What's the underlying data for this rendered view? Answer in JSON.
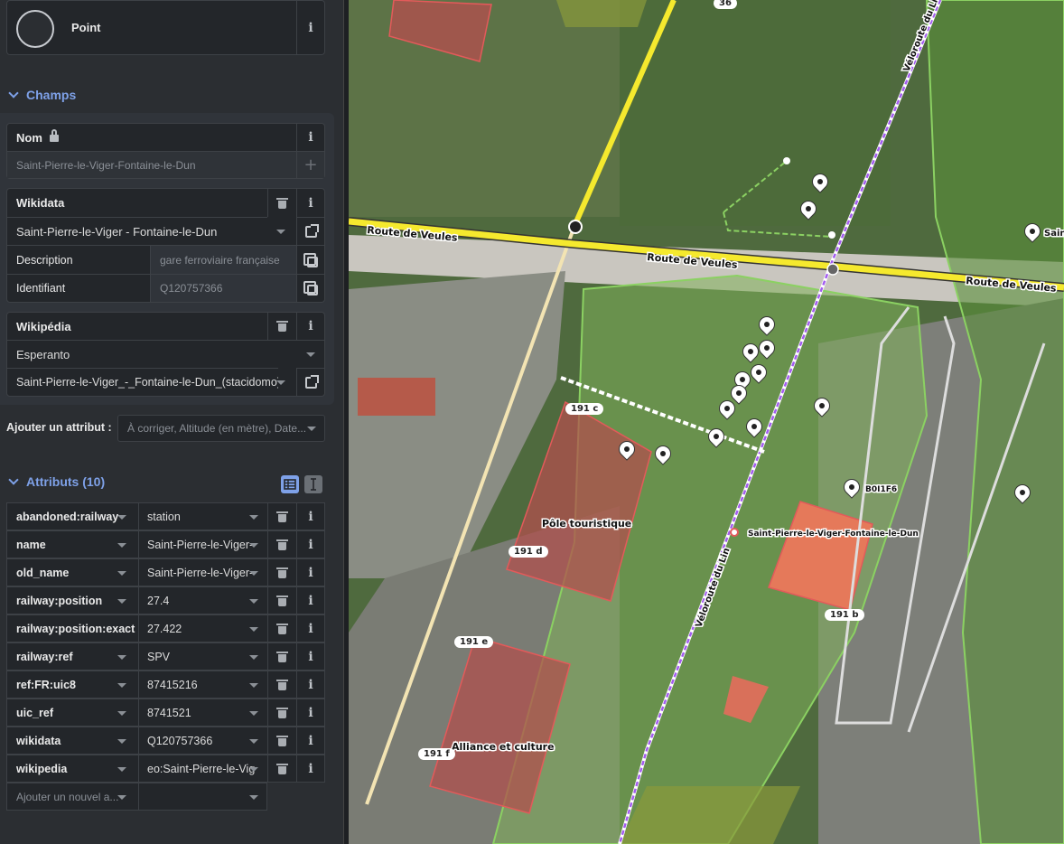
{
  "preset": {
    "name": "Point",
    "icon": "circle-icon"
  },
  "fields_section": {
    "title": "Champs"
  },
  "name_field": {
    "label": "Nom",
    "placeholder": "Saint-Pierre-le-Viger-Fontaine-le-Dun"
  },
  "wikidata_field": {
    "label": "Wikidata",
    "value": "Saint-Pierre-le-Viger - Fontaine-le-Dun",
    "description_label": "Description",
    "description_value": "gare ferroviaire française",
    "id_label": "Identifiant",
    "id_value": "Q120757366"
  },
  "wikipedia_field": {
    "label": "Wikipédia",
    "language": "Esperanto",
    "title": "Saint-Pierre-le-Viger_-_Fontaine-le-Dun_(stacidomo)"
  },
  "add_field": {
    "label": "Ajouter un attribut :",
    "placeholder": "À corriger, Altitude (en mètre), Date..."
  },
  "attributes_section": {
    "title": "Attributs (10)"
  },
  "tags": [
    {
      "key": "abandoned:railway",
      "value": "station"
    },
    {
      "key": "name",
      "value": "Saint-Pierre-le-Viger-"
    },
    {
      "key": "old_name",
      "value": "Saint-Pierre-le-Viger-"
    },
    {
      "key": "railway:position",
      "value": "27.4"
    },
    {
      "key": "railway:position:exact",
      "value": "27.422"
    },
    {
      "key": "railway:ref",
      "value": "SPV"
    },
    {
      "key": "ref:FR:uic8",
      "value": "87415216"
    },
    {
      "key": "uic_ref",
      "value": "8741521"
    },
    {
      "key": "wikidata",
      "value": "Q120757366"
    },
    {
      "key": "wikipedia",
      "value": "eo:Saint-Pierre-le-Vig"
    }
  ],
  "new_tag": {
    "placeholder": "Ajouter un nouvel a..."
  },
  "info_glyph": "i",
  "plus_glyph": "+",
  "map": {
    "road_label_1": "Route de Veules",
    "road_label_2": "Route de Veules",
    "road_label_3": "Route de Veules",
    "velo_label_1": "Véloroute du Lin",
    "velo_label_2": "Véloroute du Lin",
    "poi_1": "Pôle touristique",
    "poi_2": "Alliance et culture",
    "station_label": "Saint-Pierre-le-Viger-Fontaine-le-Dun",
    "code_label": "B0I1F6",
    "sain_label": "Sain",
    "hn_36": "36",
    "hn_191c": "191 c",
    "hn_191d": "191 d",
    "hn_191e": "191 e",
    "hn_191f": "191 f",
    "hn_191b": "191 b"
  },
  "colors": {
    "accent": "#7ea1e8",
    "road": "#f5e92e",
    "cycleway": "#a35cf0",
    "grass": "#6aa84f"
  }
}
